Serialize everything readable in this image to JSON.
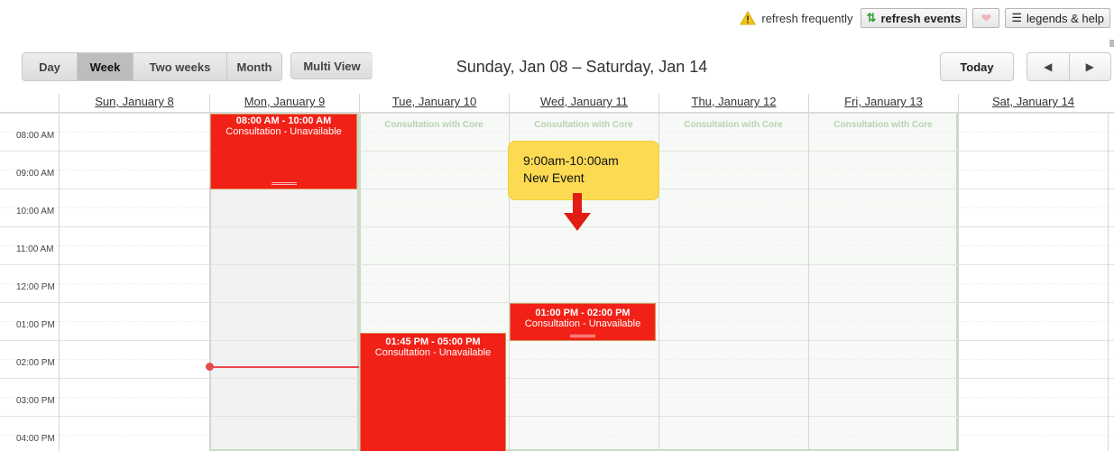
{
  "toolbar": {
    "warning_text": "refresh frequently",
    "refresh_label": "refresh events",
    "legends_label": "legends & help",
    "warning_icon": "warning-icon",
    "refresh_icon": "refresh-icon",
    "heart_icon": "heart-icon",
    "legends_icon": "list-icon"
  },
  "views": {
    "tabs": [
      "Day",
      "Week",
      "Two weeks",
      "Month"
    ],
    "active": "Week",
    "multi_view": "Multi View"
  },
  "range_title": "Sunday, Jan 08 – Saturday, Jan 14",
  "nav": {
    "today": "Today",
    "prev_icon": "chevron-left-icon",
    "next_icon": "chevron-right-icon"
  },
  "days": [
    "Sun, January 8",
    "Mon, January 9",
    "Tue, January 10",
    "Wed, January 11",
    "Thu, January 12",
    "Fri, January 13",
    "Sat, January 14"
  ],
  "times": [
    "08:00 AM",
    "09:00 AM",
    "10:00 AM",
    "11:00 AM",
    "12:00 PM",
    "01:00 PM",
    "02:00 PM",
    "03:00 PM",
    "04:00 PM"
  ],
  "availability": {
    "label": "Consultation with Core",
    "days": [
      "Tue, January 10",
      "Wed, January 11",
      "Thu, January 12",
      "Fri, January 13"
    ]
  },
  "events": [
    {
      "day": "Mon, January 9",
      "time": "08:00 AM - 10:00 AM",
      "title": "Consultation - Unavailable"
    },
    {
      "day": "Tue, January 10",
      "time": "01:45 PM - 05:00 PM",
      "title": "Consultation - Unavailable"
    },
    {
      "day": "Wed, January 11",
      "time": "01:00 PM - 02:00 PM",
      "title": "Consultation - Unavailable"
    }
  ],
  "annotation": {
    "line1": "9:00am-10:00am",
    "line2": "New Event"
  },
  "colors": {
    "event": "#f22117",
    "callout": "#fcdb52",
    "arrow": "#e11c14",
    "availability_border": "#c8dbc3",
    "now_line": "#e8484b"
  }
}
